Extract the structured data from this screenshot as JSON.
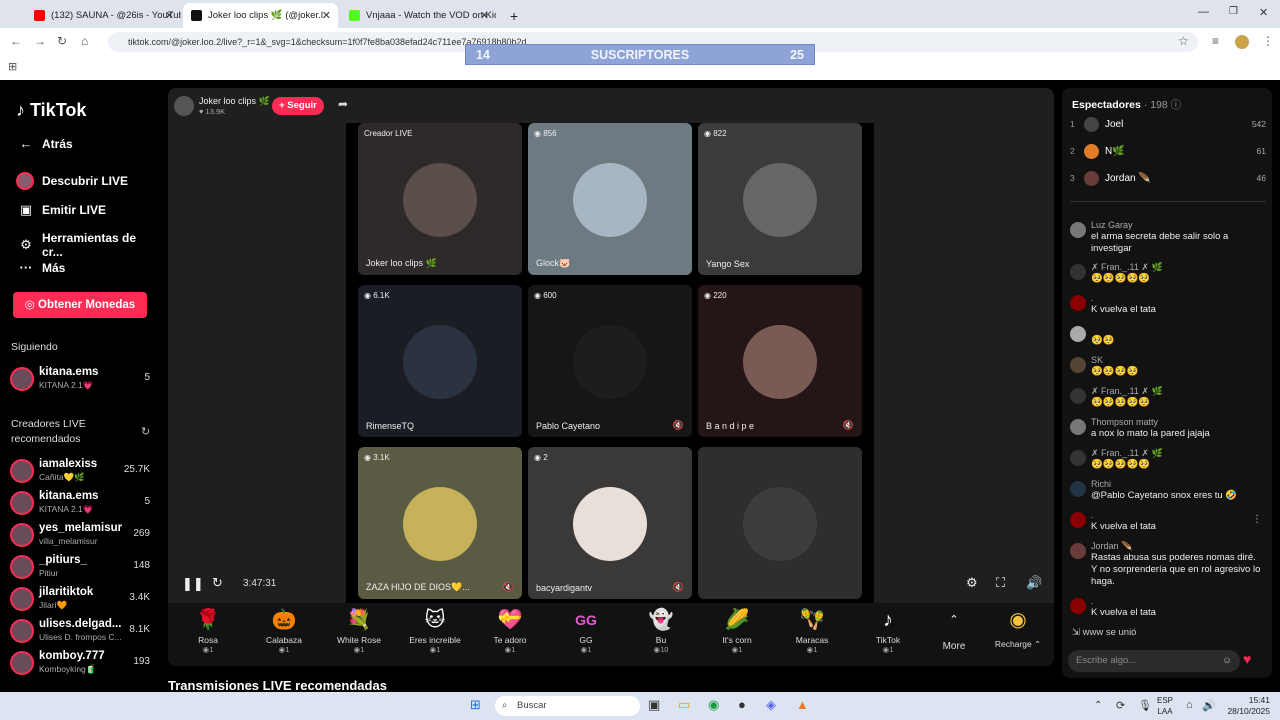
{
  "browser": {
    "tabs": [
      {
        "title": "(132) SAUNA - @26is - YouTube",
        "active": false,
        "fav_color": "#ff0000"
      },
      {
        "title": "Joker loo clips 🌿 (@joker.l",
        "active": true,
        "fav_color": "#111111"
      },
      {
        "title": "Vnjaaa - Watch the VOD on Kic",
        "active": false,
        "fav_color": "#53fc18"
      }
    ],
    "new_tab": "+",
    "url": "tiktok.com/@joker.loo.2/live?_r=1&_svg=1&checksum=1f0f7fe8ba038efad24c711ee7a76918b80b2d..."
  },
  "overlay": {
    "left": "14",
    "label": "SUSCRIPTORES",
    "right": "25"
  },
  "sidebar": {
    "logo": "TikTok",
    "nav": [
      {
        "label": "Atrás",
        "icon": "back-arrow-icon"
      },
      {
        "label": "Descubrir LIVE",
        "icon": "live-avatar-icon"
      },
      {
        "label": "Emitir LIVE",
        "icon": "camera-icon"
      },
      {
        "label": "Herramientas de cr...",
        "icon": "tools-icon"
      },
      {
        "label": "Más",
        "icon": "more-icon"
      }
    ],
    "coins": "Obtener Monedas",
    "following_header": "Siguiendo",
    "following": [
      {
        "name": "kitana.ems",
        "sub": "KITANA 2.1💗",
        "count": "5"
      }
    ],
    "recommended_header": "Creadores LIVE recomendados",
    "recommended": [
      {
        "name": "iamalexiss",
        "sub": "Cañita💛🌿",
        "count": "25.7K"
      },
      {
        "name": "kitana.ems",
        "sub": "KITANA 2.1💗",
        "count": "5"
      },
      {
        "name": "yes_melamisur",
        "sub": "villa_melamisur",
        "count": "269"
      },
      {
        "name": "_pitiurs_",
        "sub": "Pitiur",
        "count": "148"
      },
      {
        "name": "jilaritiktok",
        "sub": "Jilari🧡",
        "count": "3.4K"
      },
      {
        "name": "ulises.delgad...",
        "sub": "Ulises D. frompos C...",
        "count": "8.1K"
      },
      {
        "name": "komboy.777",
        "sub": "Komboyking🧃",
        "count": "193"
      }
    ]
  },
  "host": {
    "name": "Joker loo clips 🌿",
    "likes": "♥ 13.9K",
    "follow": "+ Seguir"
  },
  "grid": [
    {
      "name": "Joker loo clips 🌿",
      "badge": "Creador LIVE",
      "muted": false,
      "color": "#3a3333"
    },
    {
      "name": "Glock🐷",
      "badge": "856",
      "muted": false,
      "color": "#6e7a82"
    },
    {
      "name": "Yango Sex",
      "badge": "822",
      "muted": false,
      "color": "#3b3b3b"
    },
    {
      "name": "RimenseTQ",
      "badge": "6.1K",
      "muted": false,
      "color": "#1a1d24"
    },
    {
      "name": "Pablo Cayetano",
      "badge": "600",
      "muted": true,
      "color": "#161616"
    },
    {
      "name": "B a n d i p e",
      "badge": "220",
      "muted": true,
      "color": "#241616"
    },
    {
      "name": "ZAZA HIJO DE DIOS💛...",
      "badge": "3.1K",
      "muted": true,
      "color": "#5b5a43"
    },
    {
      "name": "bacyardigantv",
      "badge": "2",
      "muted": true,
      "color": "#3b3838"
    },
    {
      "name": "",
      "badge": "",
      "muted": false,
      "color": "#2e2e2e"
    }
  ],
  "timer": "3:47:31",
  "gifts": [
    {
      "name": "Rosa",
      "price": "1",
      "icon": "🌹"
    },
    {
      "name": "Calabaza",
      "price": "1",
      "icon": "🎃"
    },
    {
      "name": "White Rose",
      "price": "1",
      "icon": "💐"
    },
    {
      "name": "Eres increible",
      "price": "1",
      "icon": "🐱"
    },
    {
      "name": "Te adoro",
      "price": "1",
      "icon": "💝"
    },
    {
      "name": "GG",
      "price": "1",
      "icon": "GG"
    },
    {
      "name": "Bu",
      "price": "10",
      "icon": "👻"
    },
    {
      "name": "It's corn",
      "price": "1",
      "icon": "🌽"
    },
    {
      "name": "Maracas",
      "price": "1",
      "icon": "🪇"
    },
    {
      "name": "TikTok",
      "price": "1",
      "icon": "♪"
    }
  ],
  "more_label": "More",
  "recharge_label": "Recharge ⌃",
  "rec_header": "Transmisiones LIVE recomendadas",
  "viewers": {
    "header": "Espectadores",
    "count": "· 198",
    "top": [
      {
        "rank": "1",
        "name": "Joel",
        "score": "542",
        "color": "#555"
      },
      {
        "rank": "2",
        "name": "N🌿",
        "score": "61",
        "color": "#e07b2a"
      },
      {
        "rank": "3",
        "name": "Jordan 🪶",
        "score": "46",
        "color": "#6a3b3b"
      }
    ]
  },
  "chat": [
    {
      "user": "Luz Garay",
      "text": "el arma secreta debe salir solo a investigar",
      "color": "#777"
    },
    {
      "user": "✗ Fran._.11 ✗ 🌿",
      "text": "🥺🥺🥺🥺🥺",
      "color": "#333"
    },
    {
      "user": ".",
      "text": "K vuelva el tata",
      "color": "#8b0000"
    },
    {
      "user": "",
      "text": "🥺🥺",
      "color": "#aaa"
    },
    {
      "user": "SK",
      "text": "🥺🥺🥺🥺",
      "color": "#554433"
    },
    {
      "user": "✗ Fran._.11 ✗ 🌿",
      "text": "🥺🥺🥺🥺🥺",
      "color": "#333"
    },
    {
      "user": "Thompson matty",
      "text": "a nox lo mato la pared jajaja",
      "color": "#777"
    },
    {
      "user": "✗ Fran._.11 ✗ 🌿",
      "text": "🥺🥺🥺🥺🥺",
      "color": "#333"
    },
    {
      "user": "Richi",
      "text": "@Pablo Cayetano snox eres tu 🤣",
      "color": "#223344"
    },
    {
      "user": ".",
      "text": "K vuelva el tata",
      "color": "#8b0000"
    },
    {
      "user": "Jordan 🪶",
      "text": "Rastas abusa sus poderes nomas diré. Y no sorprendería que en rol agresivo lo haga.",
      "color": "#6a3b3b"
    },
    {
      "user": ".",
      "text": "K vuelva el tata",
      "color": "#8b0000"
    }
  ],
  "join_text": "www  se unió",
  "chat_placeholder": "Escribe algo...",
  "taskbar": {
    "search": "Buscar",
    "lang1": "ESP",
    "lang2": "LAA",
    "time": "15:41",
    "date": "28/10/2025"
  }
}
